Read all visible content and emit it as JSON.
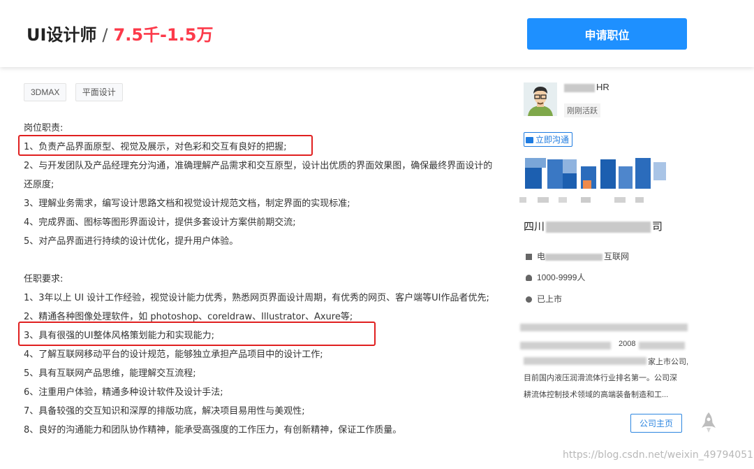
{
  "header": {
    "job_title": "UI设计师",
    "separator": "/",
    "salary": "7.5千-1.5万",
    "apply_label": "申请职位"
  },
  "tags": [
    "3DMAX",
    "平面设计"
  ],
  "duties": {
    "heading": "岗位职责:",
    "items": [
      "1、负责产品界面原型、视觉及展示，对色彩和交互有良好的把握;",
      "2、与开发团队及产品经理充分沟通，准确理解产品需求和交互原型，设计出优质的界面效果图，确保最终界面设计的还原度;",
      "3、理解业务需求，编写设计思路文档和视觉设计规范文档，制定界面的实现标准;",
      "4、完成界面、图标等图形界面设计，提供多套设计方案供前期交流;",
      "5、对产品界面进行持续的设计优化，提升用户体验。"
    ]
  },
  "requirements": {
    "heading": "任职要求:",
    "items": [
      "1、3年以上 UI 设计工作经验，视觉设计能力优秀，熟悉网页界面设计周期，有优秀的网页、客户端等UI作品者优先;",
      "2、精通各种图像处理软件，如 photoshop、coreldraw、Illustrator、Axure等;",
      "3、具有很强的UI整体风格策划能力和实现能力;",
      "4、了解互联网移动平台的设计规范，能够独立承担产品项目中的设计工作;",
      "5、具有互联网产品思维，能理解交互流程;",
      "6、注重用户体验，精通多种设计软件及设计手法;",
      "7、具备较强的交互知识和深厚的排版功底，解决项目易用性与美观性;",
      "8、良好的沟通能力和团队协作精神，能承受高强度的工作压力，有创新精神，保证工作质量。"
    ]
  },
  "recruiter": {
    "name_suffix": "HR",
    "status": "刚刚活跃",
    "chat_label": "立即沟通"
  },
  "company": {
    "name_prefix": "四川",
    "name_suffix": "司",
    "industry_prefix": "电",
    "industry_suffix": "互联网",
    "size": "1000-9999人",
    "listing": "已上市",
    "intro_year": "2008",
    "intro_line3": "家上市公司,",
    "intro_line4": "目前国内液压润滑流体行业排名第一。公司深",
    "intro_line5": "耕流体控制技术领域的高端装备制造和工...",
    "home_label": "公司主页"
  },
  "watermark": "https://blog.csdn.net/weixin_49794051",
  "colors": {
    "accent": "#1e90ff",
    "salary": "#fc3a4a",
    "highlight_box": "#e02020",
    "link": "#1e7be0"
  },
  "icons": [
    "chat-icon",
    "industry-icon",
    "people-icon",
    "listing-icon",
    "rocket-icon"
  ]
}
